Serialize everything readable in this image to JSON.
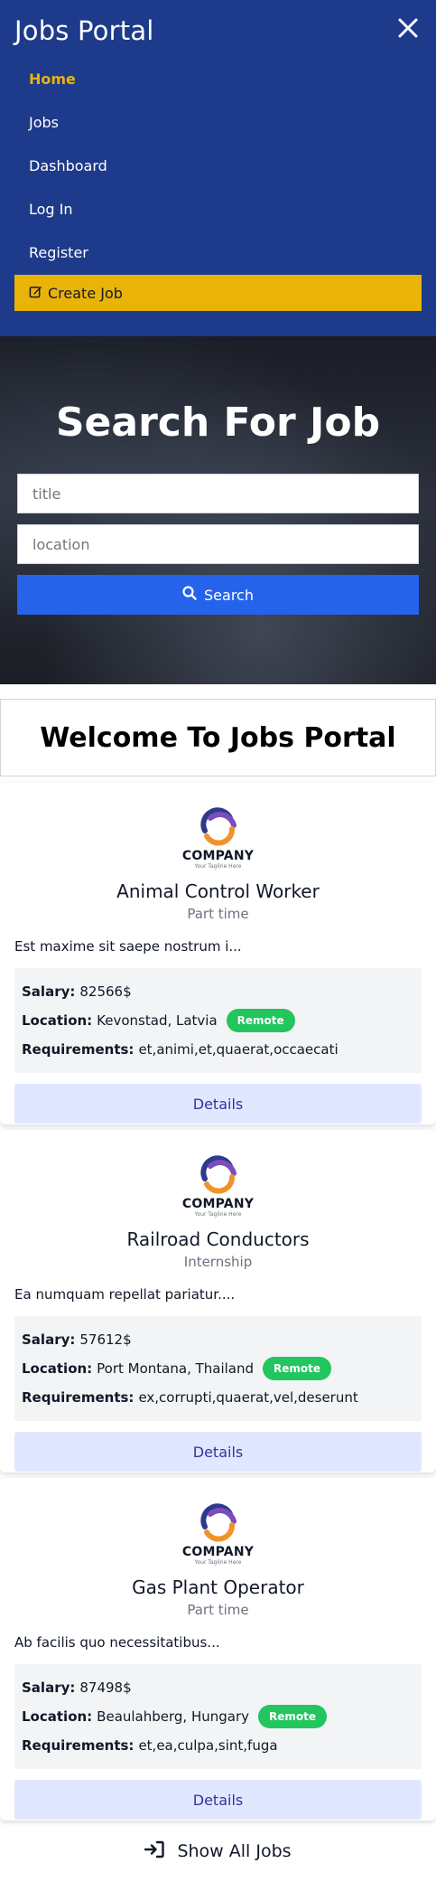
{
  "nav": {
    "brand": "Jobs Portal",
    "close_icon": "close-icon",
    "items": [
      {
        "label": "Home",
        "active": true
      },
      {
        "label": "Jobs",
        "active": false
      },
      {
        "label": "Dashboard",
        "active": false
      },
      {
        "label": "Log In",
        "active": false
      },
      {
        "label": "Register",
        "active": false
      }
    ],
    "create_job": {
      "label": "Create Job",
      "icon": "edit-icon"
    }
  },
  "hero": {
    "title": "Search For Job",
    "title_placeholder": "title",
    "location_placeholder": "location",
    "search_label": "Search",
    "search_icon": "search-icon"
  },
  "welcome": {
    "title": "Welcome To Jobs Portal"
  },
  "jobs": [
    {
      "logo_text": "COMPANY",
      "logo_tagline": "Your Tagline Here",
      "title": "Animal Control Worker",
      "type": "Part time",
      "description": "Est maxime sit saepe nostrum i...",
      "salary_label": "Salary:",
      "salary": "82566$",
      "location_label": "Location:",
      "location": "Kevonstad, Latvia",
      "remote": "Remote",
      "requirements_label": "Requirements:",
      "requirements": "et,animi,et,quaerat,occaecati",
      "details_label": "Details"
    },
    {
      "logo_text": "COMPANY",
      "logo_tagline": "Your Tagline Here",
      "title": "Railroad Conductors",
      "type": "Internship",
      "description": "Ea numquam repellat pariatur....",
      "salary_label": "Salary:",
      "salary": "57612$",
      "location_label": "Location:",
      "location": "Port Montana, Thailand",
      "remote": "Remote",
      "requirements_label": "Requirements:",
      "requirements": "ex,corrupti,quaerat,vel,deserunt",
      "details_label": "Details"
    },
    {
      "logo_text": "COMPANY",
      "logo_tagline": "Your Tagline Here",
      "title": "Gas Plant Operator",
      "type": "Part time",
      "description": "Ab facilis quo necessitatibus...",
      "salary_label": "Salary:",
      "salary": "87498$",
      "location_label": "Location:",
      "location": "Beaulahberg, Hungary",
      "remote": "Remote",
      "requirements_label": "Requirements:",
      "requirements": "et,ea,culpa,sint,fuga",
      "details_label": "Details"
    }
  ],
  "footer": {
    "show_all_label": "Show All Jobs",
    "show_all_icon": "sign-in-icon"
  },
  "colors": {
    "nav_bg": "#1e3a8a",
    "accent_yellow": "#eab308",
    "search_blue": "#2563eb",
    "remote_green": "#22c55e",
    "details_bg": "#e0e7ff"
  }
}
